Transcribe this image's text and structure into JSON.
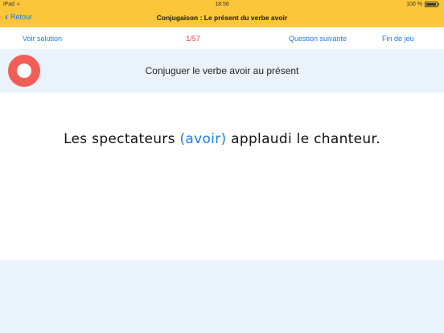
{
  "status_bar": {
    "device": "iPad",
    "time": "18:56",
    "battery": "100 %"
  },
  "nav": {
    "back_label": "Retour",
    "title": "Conjugaison : Le présent du verbe avoir"
  },
  "actions": {
    "solution_label": "Voir solution",
    "counter": "1/57",
    "next_label": "Question suivante",
    "end_label": "Fin de jeu"
  },
  "instruction": "Conjuguer le verbe avoir au présent",
  "sentence": {
    "before": "Les spectateurs ",
    "verb": "(avoir)",
    "after": " applaudi le chanteur."
  },
  "colors": {
    "nav_bar": "#fcc63a",
    "link": "#1d7ce8",
    "counter": "#e8473b",
    "band": "#eaf3fb",
    "ring": "#f25e57"
  },
  "icons": [
    "wifi-icon",
    "battery-icon",
    "back-chevron-icon",
    "timer-ring-icon"
  ]
}
